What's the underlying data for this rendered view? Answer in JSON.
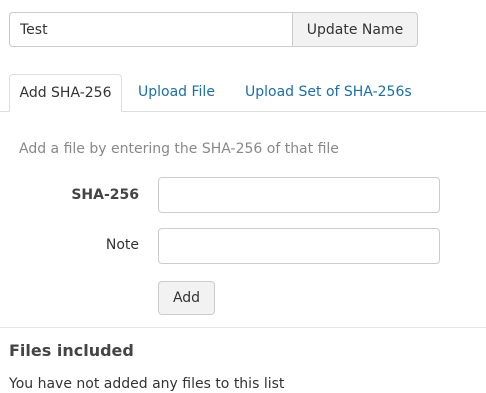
{
  "list_name": {
    "value": "Test",
    "update_label": "Update Name"
  },
  "tabs": [
    {
      "label": "Add SHA-256",
      "active": true
    },
    {
      "label": "Upload File",
      "active": false
    },
    {
      "label": "Upload Set of SHA-256s",
      "active": false
    }
  ],
  "add_form": {
    "instruction": "Add a file by entering the SHA-256 of that file",
    "sha_label": "SHA-256",
    "sha_value": "",
    "note_label": "Note",
    "note_value": "",
    "add_label": "Add"
  },
  "files_section": {
    "heading": "Files included",
    "empty_message": "You have not added any files to this list"
  },
  "colors": {
    "link": "#1a6fa8",
    "muted_text": "#888888",
    "border": "#cccccc",
    "button_bg": "#f2f2f2"
  }
}
